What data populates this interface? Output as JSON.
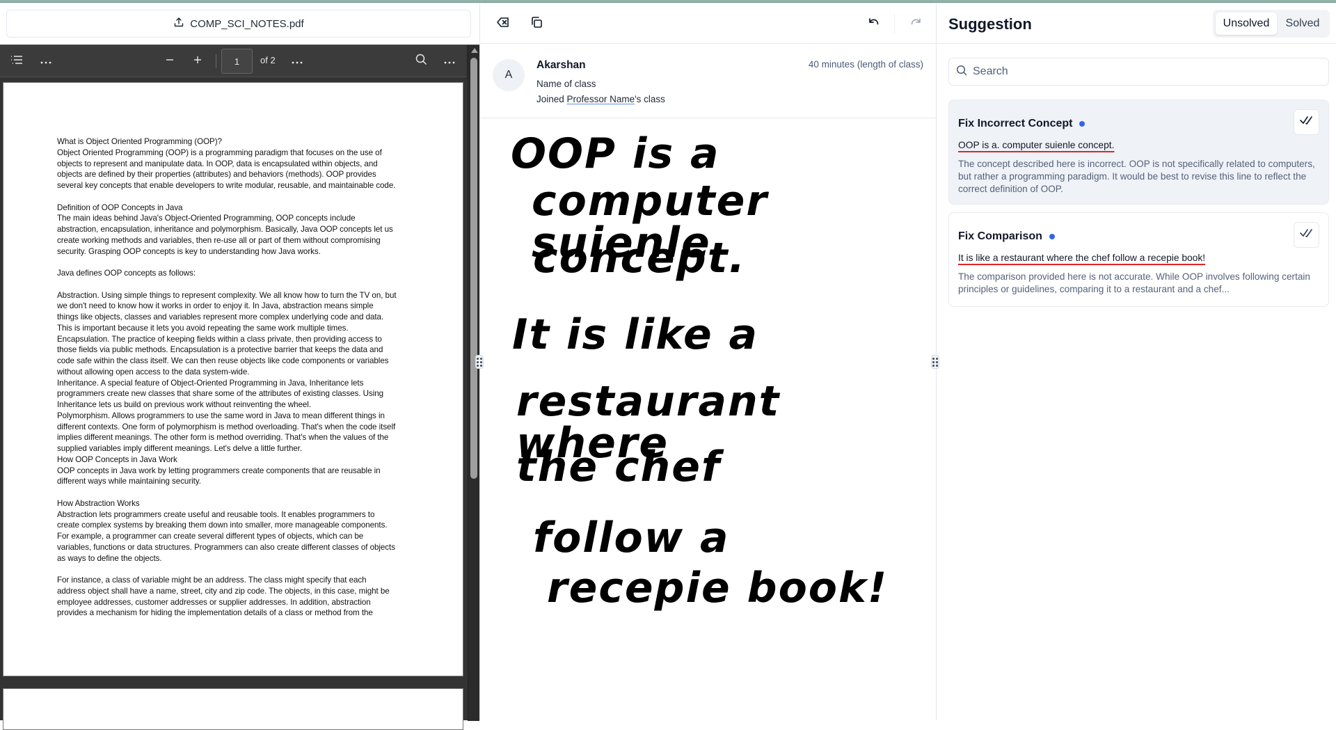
{
  "colors": {
    "accent_dot": "#3563e9",
    "error_underline": "#e02424",
    "top_strip": "#8fb5a8",
    "pdf_toolbar": "#3b3b3b"
  },
  "pdf_panel": {
    "file_name": "COMP_SCI_NOTES.pdf",
    "upload_icon": "upload-icon",
    "toolbar": {
      "outline_icon": "list-icon",
      "more_left_icon": "more-horizontal-icon",
      "zoom_out": "−",
      "zoom_in": "+",
      "page_value": "1",
      "page_of": "of 2",
      "more_center_icon": "more-horizontal-icon",
      "search_icon": "search-icon",
      "more_right_icon": "more-horizontal-icon"
    },
    "page_lines": [
      "What is Object Oriented Programming (OOP)?",
      "Object Oriented Programming (OOP) is a programming paradigm that focuses on the use of",
      "objects to represent and manipulate data. In OOP, data is encapsulated within objects, and",
      "objects are defined by their properties (attributes) and behaviors (methods). OOP provides",
      "several key concepts that enable developers to write modular, reusable, and maintainable code.",
      "",
      "Definition of OOP Concepts in Java",
      "The main ideas behind Java's Object-Oriented Programming, OOP concepts include",
      "abstraction, encapsulation, inheritance and polymorphism. Basically, Java OOP concepts let us",
      "create working methods and variables, then re-use all or part of them without compromising",
      "security. Grasping OOP concepts is key to understanding how Java works.",
      "",
      "Java defines OOP concepts as follows:",
      "",
      "Abstraction. Using simple things to represent complexity. We all know how to turn the TV on, but",
      "we don't need to know how it works in order to enjoy it. In Java, abstraction means simple",
      "things like objects, classes and variables represent more complex underlying code and data.",
      "This is important because it lets you avoid repeating the same work multiple times.",
      "Encapsulation. The practice of keeping fields within a class private, then providing access to",
      "those fields via public methods. Encapsulation is a protective barrier that keeps the data and",
      "code safe within the class itself. We can then reuse objects like code components or variables",
      "without allowing open access to the data system-wide.",
      "Inheritance. A special feature of Object-Oriented Programming in Java, Inheritance lets",
      "programmers create new classes that share some of the attributes of existing classes. Using",
      "Inheritance lets us build on previous work without reinventing the wheel.",
      "Polymorphism. Allows programmers to use the same word in Java to mean different things in",
      "different contexts. One form of polymorphism is method overloading. That's when the code itself",
      "implies different meanings. The other form is method overriding. That's when the values of the",
      "supplied variables imply different meanings. Let's delve a little further.",
      "How OOP Concepts in Java Work",
      "OOP concepts in Java work by letting programmers create components that are reusable in",
      "different ways while maintaining security.",
      "",
      "How Abstraction Works",
      "Abstraction lets programmers create useful and reusable tools. It enables programmers to",
      "create complex systems by breaking them down into smaller, more manageable components.",
      "For example, a programmer can create several different types of objects, which can be",
      "variables, functions or data structures. Programmers can also create different classes of objects",
      "as ways to define the objects.",
      "",
      "For instance, a class of variable might be an address. The class might specify that each",
      "address object shall have a name, street, city and zip code. The objects, in this case, might be",
      "employee addresses, customer addresses or supplier addresses. In addition, abstraction",
      "provides a mechanism for hiding the implementation details of a class or method from the"
    ]
  },
  "workspace": {
    "toolbar": {
      "clear_icon": "backspace-clear-icon",
      "copy_icon": "copy-icon",
      "undo_icon": "undo-icon",
      "redo_icon": "redo-icon"
    },
    "student": {
      "avatar_initial": "A",
      "name": "Akarshan",
      "class_name": "Name of class",
      "joined_prefix": "Joined ",
      "professor": "Professor Name",
      "joined_suffix": "'s class",
      "duration": "40 minutes (length of class)"
    },
    "handwriting_lines": [
      "OOP is a",
      "computer suienle",
      "concept.",
      "It is like a",
      "restaurant where",
      "the chef",
      "follow a",
      "recepie book!"
    ]
  },
  "suggestions": {
    "title": "Suggestion",
    "tabs": [
      {
        "label": "Unsolved",
        "active": true
      },
      {
        "label": "Solved",
        "active": false
      }
    ],
    "search_placeholder": "Search",
    "search_value": "",
    "items": [
      {
        "title": "Fix Incorrect Concept",
        "quote": "OOP is a. computer suienle concept.",
        "description": "The concept described here is incorrect. OOP is not specifically related to computers, but rather a programming paradigm. It would be best to revise this line to reflect the correct definition of OOP.",
        "resolve_icon": "double-check-icon"
      },
      {
        "title": "Fix Comparison",
        "quote": "It is like a restaurant where the chef follow a recepie book!",
        "description": "The comparison provided here is not accurate. While OOP involves following certain principles or guidelines, comparing it to a restaurant and a chef...",
        "resolve_icon": "double-check-icon"
      }
    ]
  }
}
